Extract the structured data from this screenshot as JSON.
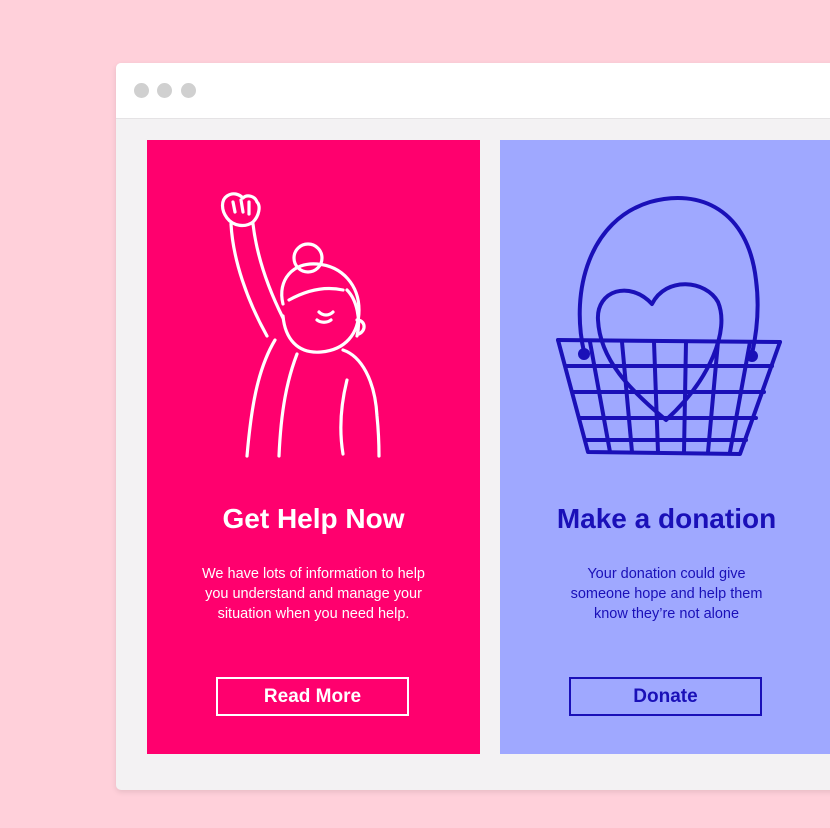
{
  "window": {
    "controls": [
      "window-dot",
      "window-dot",
      "window-dot"
    ]
  },
  "cards": [
    {
      "title": "Get Help Now",
      "description": [
        "We have lots of information to help",
        "you understand and manage your",
        "situation when you need help."
      ],
      "button_label": "Read More",
      "illustration_icon": "raised-fist-person-icon",
      "background": "#ff006e",
      "foreground": "#ffffff"
    },
    {
      "title": "Make a donation",
      "description": [
        "Your donation could give",
        "someone hope and help them",
        "know they’re not alone"
      ],
      "button_label": "Donate",
      "illustration_icon": "heart-basket-icon",
      "background": "#9fa8ff",
      "foreground": "#1a10b8"
    }
  ],
  "colors": {
    "page_background": "#ffd0da",
    "window_body": "#f3f2f3",
    "titlebar": "#ffffff",
    "window_dot": "#d0d0d0"
  }
}
